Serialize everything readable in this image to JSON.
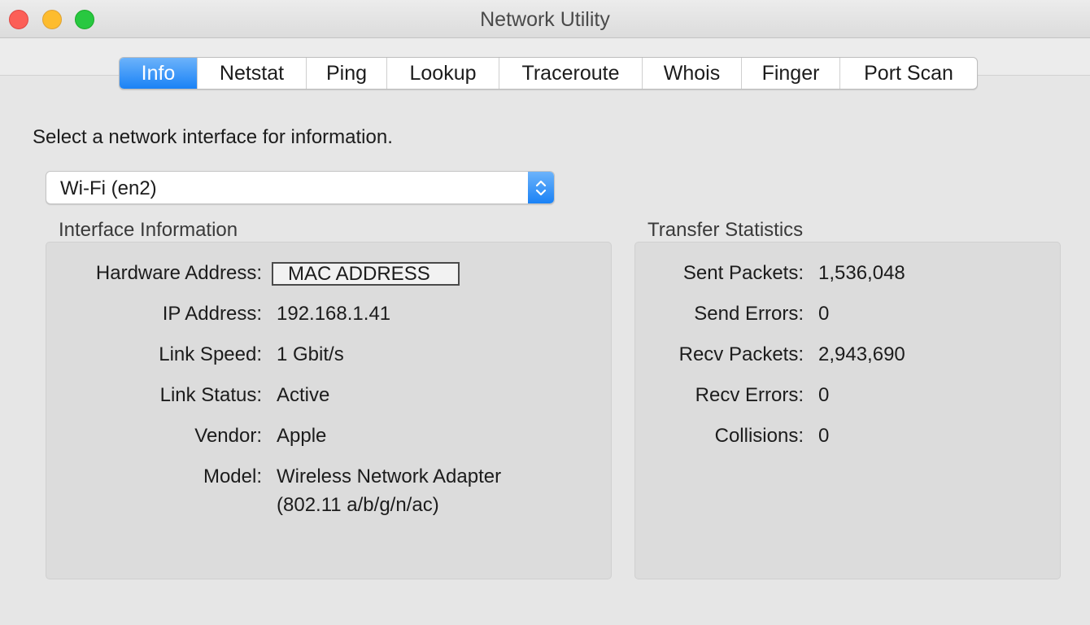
{
  "window": {
    "title": "Network Utility"
  },
  "tabs": [
    {
      "label": "Info",
      "active": true
    },
    {
      "label": "Netstat",
      "active": false
    },
    {
      "label": "Ping",
      "active": false
    },
    {
      "label": "Lookup",
      "active": false
    },
    {
      "label": "Traceroute",
      "active": false
    },
    {
      "label": "Whois",
      "active": false
    },
    {
      "label": "Finger",
      "active": false
    },
    {
      "label": "Port Scan",
      "active": false
    }
  ],
  "instruction": "Select a network interface for information.",
  "interface_select": {
    "value": "Wi-Fi (en2)"
  },
  "interface_info": {
    "title": "Interface Information",
    "rows": [
      {
        "label": "Hardware Address:",
        "value": "MAC ADDRESS"
      },
      {
        "label": "IP Address:",
        "value": "192.168.1.41"
      },
      {
        "label": "Link Speed:",
        "value": "1 Gbit/s"
      },
      {
        "label": "Link Status:",
        "value": "Active"
      },
      {
        "label": "Vendor:",
        "value": "Apple"
      },
      {
        "label": "Model:",
        "value": "Wireless Network Adapter",
        "value2": "(802.11 a/b/g/n/ac)"
      }
    ]
  },
  "transfer_stats": {
    "title": "Transfer Statistics",
    "rows": [
      {
        "label": "Sent Packets:",
        "value": "1,536,048"
      },
      {
        "label": "Send Errors:",
        "value": "0"
      },
      {
        "label": "Recv Packets:",
        "value": "2,943,690"
      },
      {
        "label": "Recv Errors:",
        "value": "0"
      },
      {
        "label": "Collisions:",
        "value": "0"
      }
    ]
  },
  "colors": {
    "accent": "#1a82f6",
    "window_bg": "#e6e6e6",
    "group_bg": "#dcdcdc"
  },
  "icons": {
    "select_arrows": "up-down-chevron-icon"
  }
}
